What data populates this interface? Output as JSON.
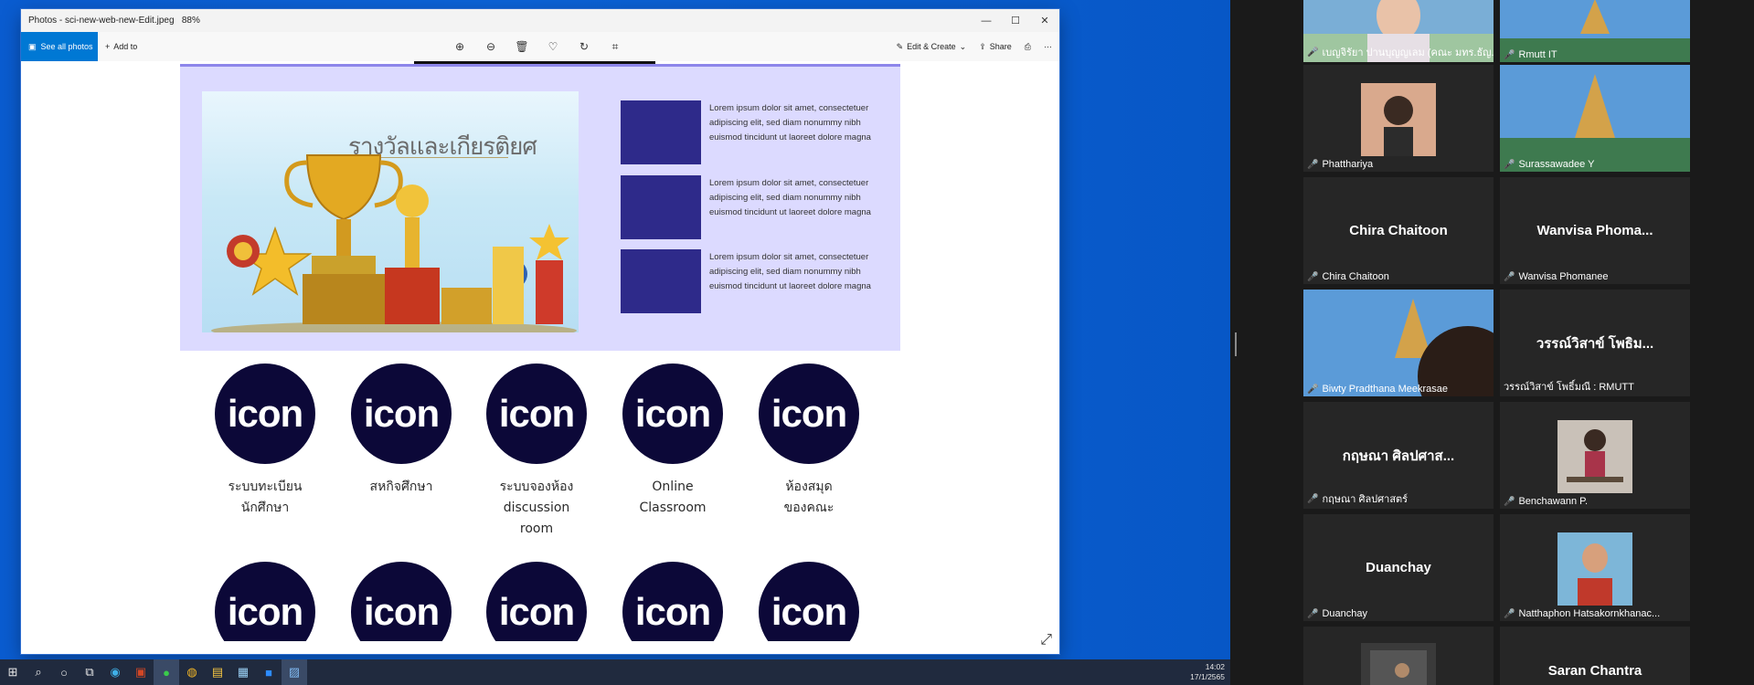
{
  "window": {
    "title": "Photos - sci-new-web-new-Edit.jpeg",
    "zoom": "88%",
    "minimize": "—",
    "maximize": "☐",
    "close": "✕"
  },
  "toolbar": {
    "see_all": "See all photos",
    "add_to": "Add to",
    "edit_create": "Edit & Create",
    "share": "Share"
  },
  "image": {
    "hero_title": "รางวัลและเกียรติยศ",
    "items": [
      "Lorem ipsum dolor sit amet, consectetuer adipiscing elit, sed diam nonummy nibh euismod tincidunt ut laoreet dolore magna",
      "Lorem ipsum dolor sit amet, consectetuer adipiscing elit, sed diam nonummy nibh euismod tincidunt ut laoreet dolore magna",
      "Lorem ipsum dolor sit amet, consectetuer adipiscing elit, sed diam nonummy nibh euismod tincidunt ut laoreet dolore magna"
    ],
    "icon_text": "icon",
    "icon_labels": [
      [
        "ระบบทะเบียน",
        "นักศึกษา"
      ],
      [
        "สหกิจศึกษา",
        ""
      ],
      [
        "ระบบจองห้อง",
        "discussion room"
      ],
      [
        "Online",
        "Classroom"
      ],
      [
        "ห้องสมุด",
        "ของคณะ"
      ]
    ]
  },
  "taskbar": {
    "time": "14:02",
    "date": "17/1/2565"
  },
  "zoom": {
    "participants": [
      {
        "name": "เบญจิรัยา ปานบุญญเลม (คณะ มทร.ธัญ...",
        "big": "",
        "speaking": true
      },
      {
        "name": "Rmutt IT",
        "big": ""
      },
      {
        "name": "Phatthariya",
        "big": ""
      },
      {
        "name": "Surassawadee Y",
        "big": ""
      },
      {
        "name": "Chira Chaitoon",
        "big": "Chira Chaitoon"
      },
      {
        "name": "Wanvisa Phomanee",
        "big": "Wanvisa  Phoma..."
      },
      {
        "name": "Biwty Pradthana Meekrasae",
        "big": ""
      },
      {
        "name": "วรรณ์วิสาข์ โพธิ์มณี : RMUTT",
        "big": "วรรณ์วิสาข์ โพธิม..."
      },
      {
        "name": "กฤษณา  ศิลปศาสตร์",
        "big": "กฤษณา  ศิลปศาส..."
      },
      {
        "name": "Benchawann P.",
        "big": ""
      },
      {
        "name": "Duanchay",
        "big": "Duanchay"
      },
      {
        "name": "Natthaphon Hatsakornkhanac...",
        "big": ""
      },
      {
        "name": "",
        "big": ""
      },
      {
        "name": "",
        "big": "Saran Chantra"
      }
    ]
  },
  "colors": {
    "accent": "#0078d4",
    "hero_bg": "#dcdaff",
    "square": "#2e2a8a",
    "icon_circle": "#0c0838",
    "desktop": "#0a5cd0",
    "zoom_bg": "#1a1a1a"
  }
}
